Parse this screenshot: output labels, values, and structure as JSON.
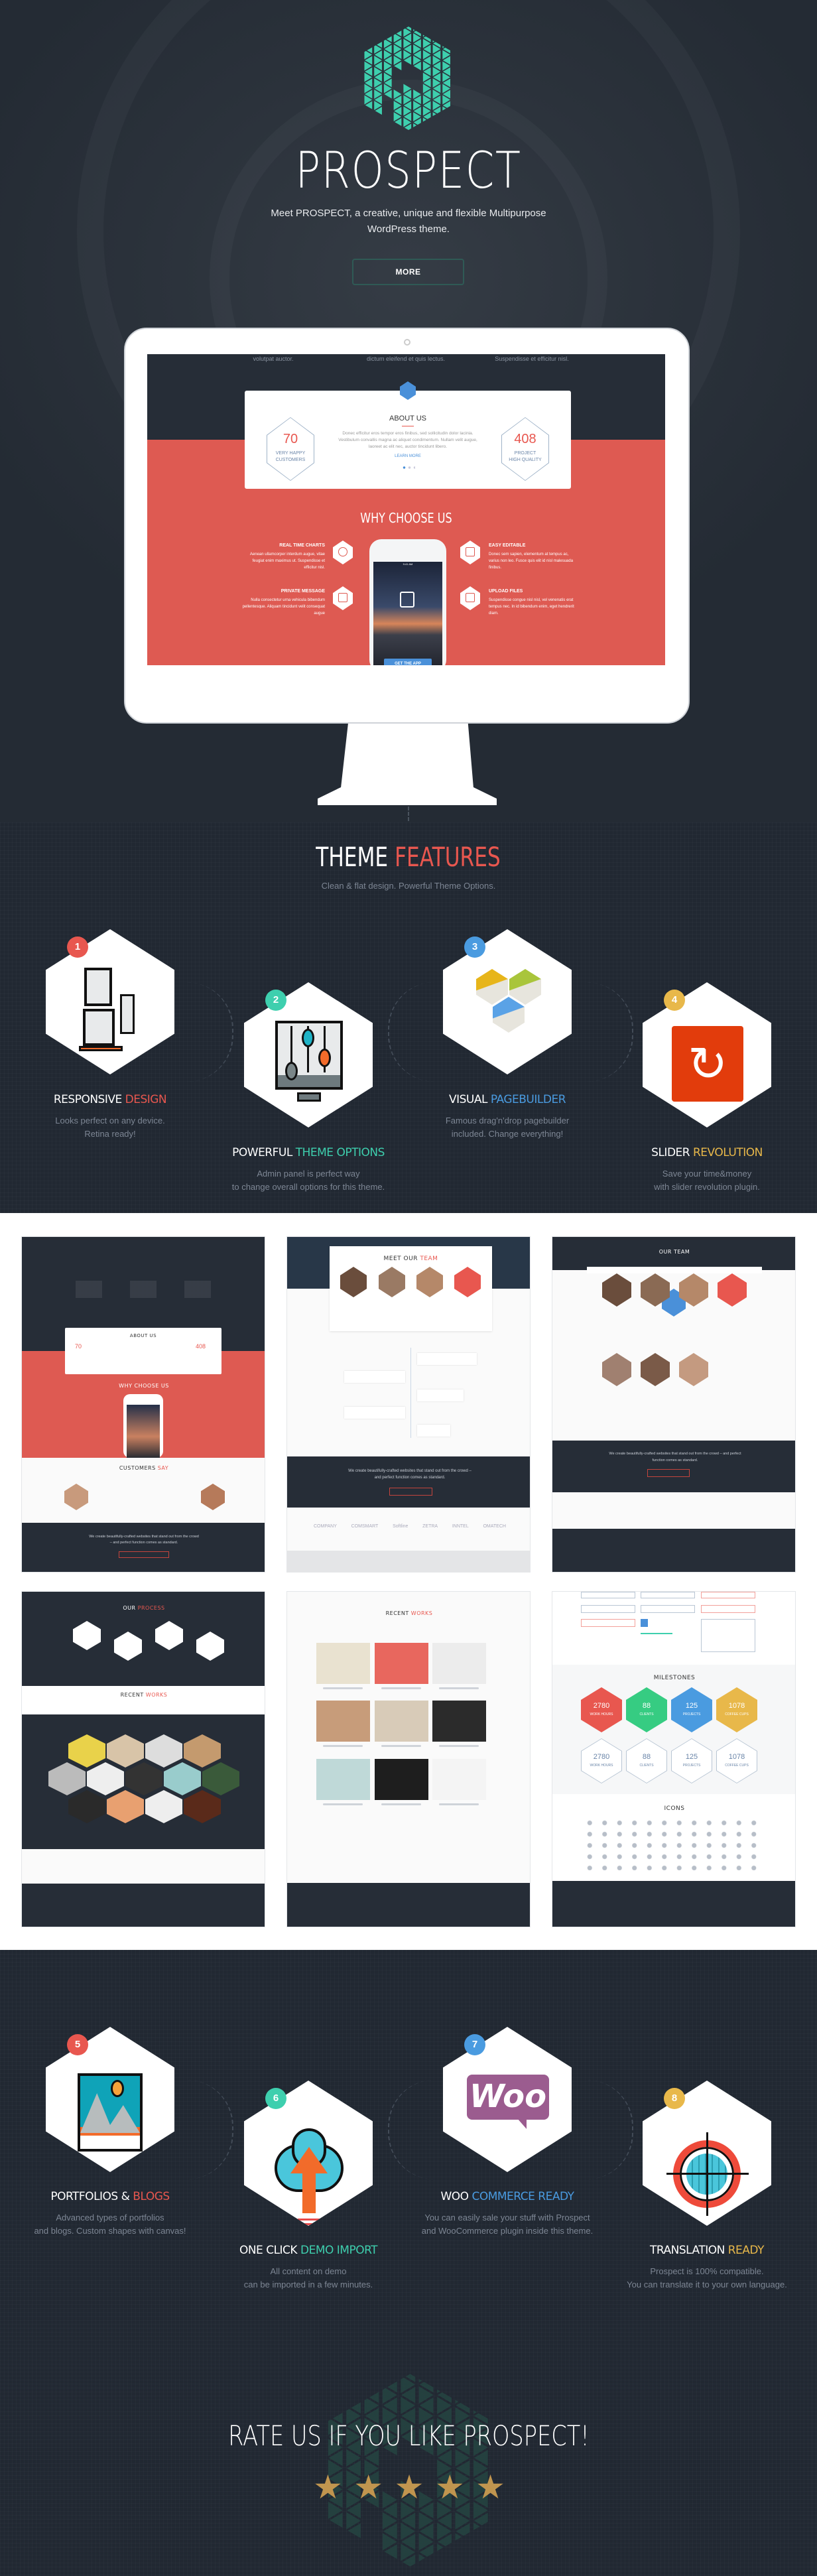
{
  "hero": {
    "brand": "PROSPECT",
    "tagline_line1": "Meet PROSPECT,  a creative, unique and flexible Multipurpose",
    "tagline_line2": "WordPress theme.",
    "more_label": "MORE",
    "logo_color": "#3ecfae"
  },
  "monitor_screen": {
    "top_captions": [
      "volutpat auctor.",
      "dictum eleifend et quis lectus.",
      "Suspendisse et efficitur nisl."
    ],
    "about": {
      "title": "ABOUT US",
      "text": "Donec efficitur eros tempor eros finibus, sed sollicitudin dolor lacinia. Vestibulum convallis magna ac aliquet condimentum. Nullam velit augue, laoreet ac elit nec, auctor tincidunt libero.",
      "link": "LEARN MORE",
      "stat_left": {
        "value": "70",
        "label1": "VERY HAPPY",
        "label2": "CUSTOMERS"
      },
      "stat_right": {
        "value": "408",
        "label1": "PROJECT",
        "label2": "HIGH QUALITY"
      }
    },
    "why_title": "WHY CHOOSE US",
    "features": [
      {
        "title": "REAL TIME CHARTS",
        "text": "Aenean ullamcorper interdum augue, vitae feugiat enim maximus ut. Suspendisse et efficitur nisl.",
        "icon": "pie-chart-icon"
      },
      {
        "title": "PRIVATE MESSAGE",
        "text": "Nulla consectetur urna vehicula bibendum pellentesque. Aliquam tincidunt velit consequat augue",
        "icon": "envelope-icon"
      },
      {
        "title": "EASY EDITABLE",
        "text": "Donec sem sapien, elementum at tempus ac, varius non leo. Fusce quis elit id nisl malesuada finibus.",
        "icon": "pencil-icon"
      },
      {
        "title": "UPLOAD FILES",
        "text": "Suspendisse congue nisl nisl, vel venenatis erat tempus nec. In id bibendum enim, eget hendrerit diam.",
        "icon": "upload-cloud-icon"
      }
    ],
    "phone": {
      "time": "9:41 AM",
      "button": "GET THE APP"
    },
    "colors": {
      "red": "#de5a52",
      "dark": "#262d37",
      "blue": "#4a90d9"
    }
  },
  "theme_features": {
    "title_a": "THEME",
    "title_b": "FEATURES",
    "subtitle": "Clean & flat design. Powerful Theme Options.",
    "items": [
      {
        "num": "1",
        "title_a": "RESPONSIVE",
        "title_b": "DESIGN",
        "color": "#e8574f",
        "desc1": "Looks perfect on any device.",
        "desc2": "Retina ready!",
        "icon": "responsive-devices-icon"
      },
      {
        "num": "2",
        "title_a": "POWERFUL",
        "title_b": "THEME OPTIONS",
        "color": "#3ecfae",
        "desc1": "Admin panel is perfect way",
        "desc2": "to change overall options for this theme.",
        "icon": "sliders-monitor-icon"
      },
      {
        "num": "3",
        "title_a": "VISUAL",
        "title_b": "PAGEBUILDER",
        "color": "#4a9be0",
        "desc1": "Famous drag'n'drop pagebuilder",
        "desc2": "included. Change everything!",
        "icon": "pagebuilder-cubes-icon"
      },
      {
        "num": "4",
        "title_a": "SLIDER",
        "title_b": "REVOLUTION",
        "color": "#e8b84a",
        "desc1": "Save your time&money",
        "desc2": "with slider revolution plugin.",
        "icon": "refresh-icon"
      },
      {
        "num": "5",
        "title_a": "PORTFOLIOS &",
        "title_b": "BLOGS",
        "color": "#e8574f",
        "desc1": "Advanced types of portfolios",
        "desc2": "and blogs. Custom shapes with canvas!",
        "icon": "picture-icon"
      },
      {
        "num": "6",
        "title_a": "ONE CLICK",
        "title_b": "DEMO IMPORT",
        "color": "#3ecfae",
        "desc1": "All content on demo",
        "desc2": "can be imported in a few minutes.",
        "icon": "cloud-upload-icon"
      },
      {
        "num": "7",
        "title_a": "WOO",
        "title_b": "COMMERCE READY",
        "color": "#4a9be0",
        "desc1": "You can easily sale your stuff with Prospect",
        "desc2": "and WooCommerce plugin inside this theme.",
        "icon": "woo-logo-icon",
        "woo_text": "Woo"
      },
      {
        "num": "8",
        "title_a": "TRANSLATION",
        "title_b": "READY",
        "color": "#e8b84a",
        "desc1": "Prospect is 100% compatible.",
        "desc2": "You can translate it to your own language.",
        "icon": "globe-target-icon"
      }
    ]
  },
  "previews": {
    "p1": {
      "about": "ABOUT US",
      "why": "WHY CHOOSE US",
      "customers_a": "CUSTOMERS",
      "customers_b": "SAY",
      "s1": "70",
      "s2": "408",
      "quote": "We create beautifully-crafted websites that stand out from the crowd – and perfect function comes as standard."
    },
    "p2": {
      "title_a": "MEET OUR",
      "title_b": "TEAM",
      "quote": "We create beautifully-crafted websites that stand out from the crowd – and perfect function comes as standard.",
      "logos": [
        "COMPANY",
        "COMSMART",
        "Softline",
        "ZETRA",
        "INNTEL",
        "OMATECH"
      ]
    },
    "p3": {
      "title": "OUR TEAM",
      "quote": "We create beautifully-crafted websites that stand out from the crowd – and perfect function comes as standard."
    },
    "p4": {
      "process_a": "OUR",
      "process_b": "PROCESS",
      "works_a": "RECENT",
      "works_b": "WORKS"
    },
    "p5": {
      "works_a": "RECENT",
      "works_b": "WORKS"
    },
    "p6": {
      "milestones": "MILESTONES",
      "icons": "ICONS",
      "stats": [
        {
          "v": "2780",
          "l": "WORK HOURS",
          "c": "#e8574f"
        },
        {
          "v": "88",
          "l": "CLIENTS",
          "c": "#36cc82"
        },
        {
          "v": "125",
          "l": "PROJECTS",
          "c": "#4a9be0"
        },
        {
          "v": "1078",
          "l": "COFFEE CUPS",
          "c": "#e8b84a"
        }
      ]
    }
  },
  "rate": {
    "title": "RATE US IF YOU LIKE PROSPECT!",
    "stars": 5,
    "star_color": "#c0954f"
  }
}
